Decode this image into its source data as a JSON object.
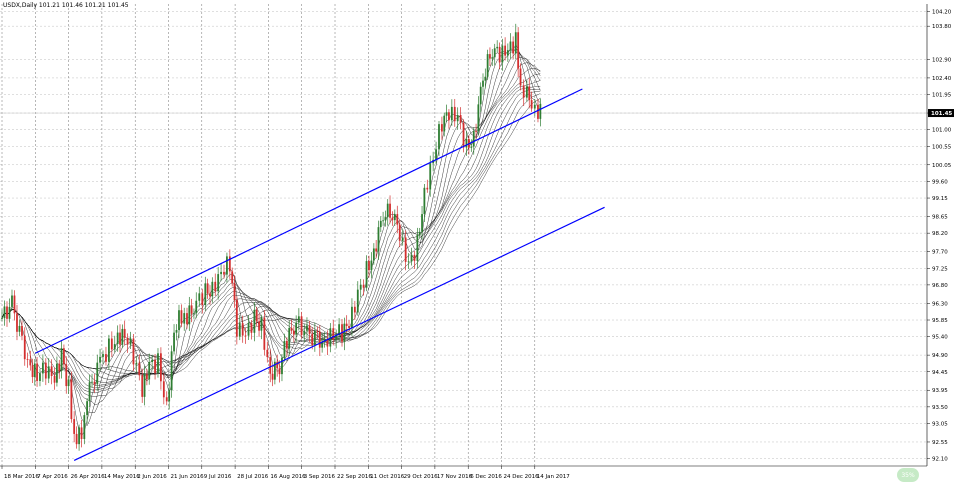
{
  "window": {
    "title": "USDX,Daily  101.21 101.46 101.21 101.45"
  },
  "price_axis": {
    "ticks": [
      "104.20",
      "103.80",
      "102.90",
      "102.40",
      "101.95",
      "101.45",
      "101.00",
      "100.55",
      "100.05",
      "99.60",
      "99.15",
      "98.65",
      "98.20",
      "97.70",
      "97.25",
      "96.80",
      "96.30",
      "95.85",
      "95.40",
      "94.90",
      "94.45",
      "93.95",
      "93.50",
      "93.05",
      "92.55",
      "92.10"
    ],
    "current_bid": "101.45",
    "bid_color": "#000000"
  },
  "time_axis": {
    "labels": [
      "18 Mar 2016",
      "7 Apr 2016",
      "26 Apr 2016",
      "14 May 2016",
      "2 Jun 2016",
      "21 Jun 2016",
      "9 Jul 2016",
      "28 Jul 2016",
      "16 Aug 2016",
      "3 Sep 2016",
      "22 Sep 2016",
      "11 Oct 2016",
      "29 Oct 2016",
      "17 Nov 2016",
      "6 Dec 2016",
      "24 Dec 2016",
      "14 Jan 2017"
    ]
  },
  "colors": {
    "bull_candle": "#2e7d32",
    "bear_candle": "#d32f2f",
    "ma_ribbon": "#000000",
    "channel_lines": "#0000ff",
    "grid": "#bfbfbf"
  },
  "indicators": {
    "ma_ribbon_count": 14
  },
  "annotations": [
    "upper-channel-line",
    "lower-channel-line"
  ],
  "status": {
    "badge": "35%"
  },
  "chart_data": {
    "type": "candlestick",
    "title": "USDX,Daily  101.21 101.46 101.21 101.45",
    "x_range": [
      "2016-03-18",
      "2017-01-20"
    ],
    "ylim": [
      91.9,
      104.4
    ],
    "grid": true,
    "close_path": [
      [
        "2016-03-18",
        95.9
      ],
      [
        "2016-03-24",
        96.3
      ],
      [
        "2016-03-30",
        95.2
      ],
      [
        "2016-04-04",
        94.6
      ],
      [
        "2016-04-08",
        94.4
      ],
      [
        "2016-04-13",
        94.5
      ],
      [
        "2016-04-18",
        94.2
      ],
      [
        "2016-04-22",
        94.9
      ],
      [
        "2016-04-26",
        94.0
      ],
      [
        "2016-04-29",
        92.7
      ],
      [
        "2016-05-03",
        92.8
      ],
      [
        "2016-05-06",
        93.9
      ],
      [
        "2016-05-10",
        94.2
      ],
      [
        "2016-05-13",
        94.7
      ],
      [
        "2016-05-18",
        95.1
      ],
      [
        "2016-05-23",
        95.4
      ],
      [
        "2016-05-27",
        95.5
      ],
      [
        "2016-06-01",
        94.9
      ],
      [
        "2016-06-06",
        93.9
      ],
      [
        "2016-06-10",
        94.6
      ],
      [
        "2016-06-15",
        94.7
      ],
      [
        "2016-06-20",
        93.5
      ],
      [
        "2016-06-24",
        95.6
      ],
      [
        "2016-06-28",
        96.0
      ],
      [
        "2016-07-01",
        95.9
      ],
      [
        "2016-07-06",
        96.3
      ],
      [
        "2016-07-11",
        96.6
      ],
      [
        "2016-07-15",
        96.7
      ],
      [
        "2016-07-20",
        97.2
      ],
      [
        "2016-07-25",
        97.4
      ],
      [
        "2016-07-29",
        95.6
      ],
      [
        "2016-08-03",
        95.4
      ],
      [
        "2016-08-08",
        95.9
      ],
      [
        "2016-08-12",
        95.7
      ],
      [
        "2016-08-17",
        94.4
      ],
      [
        "2016-08-22",
        94.6
      ],
      [
        "2016-08-26",
        95.3
      ],
      [
        "2016-08-31",
        95.8
      ],
      [
        "2016-09-06",
        95.5
      ],
      [
        "2016-09-12",
        95.3
      ],
      [
        "2016-09-16",
        95.3
      ],
      [
        "2016-09-21",
        95.5
      ],
      [
        "2016-09-26",
        95.5
      ],
      [
        "2016-09-30",
        95.7
      ],
      [
        "2016-10-05",
        96.5
      ],
      [
        "2016-10-10",
        97.2
      ],
      [
        "2016-10-14",
        97.7
      ],
      [
        "2016-10-19",
        98.7
      ],
      [
        "2016-10-24",
        98.8
      ],
      [
        "2016-10-28",
        98.1
      ],
      [
        "2016-11-02",
        97.3
      ],
      [
        "2016-11-07",
        97.9
      ],
      [
        "2016-11-11",
        99.3
      ],
      [
        "2016-11-16",
        100.3
      ],
      [
        "2016-11-21",
        101.2
      ],
      [
        "2016-11-25",
        101.4
      ],
      [
        "2016-11-30",
        101.3
      ],
      [
        "2016-12-05",
        100.5
      ],
      [
        "2016-12-09",
        100.8
      ],
      [
        "2016-12-14",
        102.4
      ],
      [
        "2016-12-19",
        103.2
      ],
      [
        "2016-12-23",
        103.0
      ],
      [
        "2016-12-28",
        103.1
      ],
      [
        "2017-01-02",
        103.4
      ],
      [
        "2017-01-05",
        102.0
      ],
      [
        "2017-01-09",
        102.2
      ],
      [
        "2017-01-12",
        101.8
      ],
      [
        "2017-01-16",
        101.5
      ],
      [
        "2017-01-19",
        101.45
      ]
    ],
    "channel": {
      "upper": [
        [
          "2016-04-07",
          94.95
        ],
        [
          "2017-02-13",
          102.1
        ]
      ],
      "lower": [
        [
          "2016-04-29",
          92.05
        ],
        [
          "2017-02-27",
          98.9
        ]
      ]
    }
  }
}
